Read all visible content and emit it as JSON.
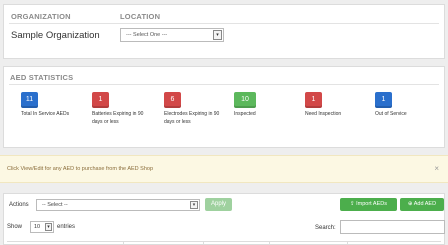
{
  "organization": {
    "heading": "ORGANIZATION",
    "name": "Sample Organization"
  },
  "location": {
    "heading": "LOCATION",
    "selected": "--- Select One ---"
  },
  "stats": {
    "heading": "AED STATISTICS",
    "items": [
      {
        "count": "11",
        "label": "Total In Service AEDs",
        "color": "#2a6fcc"
      },
      {
        "count": "1",
        "label": "Batteries Expiring in 90 days or less",
        "color": "#d24848"
      },
      {
        "count": "6",
        "label": "Electrodes Expiring in 90 days or less",
        "color": "#d24848"
      },
      {
        "count": "10",
        "label": "Inspected",
        "color": "#5cb85c"
      },
      {
        "count": "1",
        "label": "Need Inspection",
        "color": "#d24848"
      },
      {
        "count": "1",
        "label": "Out of Service",
        "color": "#2a6fcc"
      }
    ]
  },
  "alert": {
    "text": "Click View/Edit for any AED to purchase from the AED Shop",
    "close": "×"
  },
  "actions": {
    "label": "Actions",
    "selected": "-- Select --",
    "apply": "Apply",
    "import": "Import AEDs",
    "add": "Add AED"
  },
  "table": {
    "show_label": "Show",
    "page_length": "10",
    "entries_label": "entries",
    "search_label": "Search:"
  }
}
